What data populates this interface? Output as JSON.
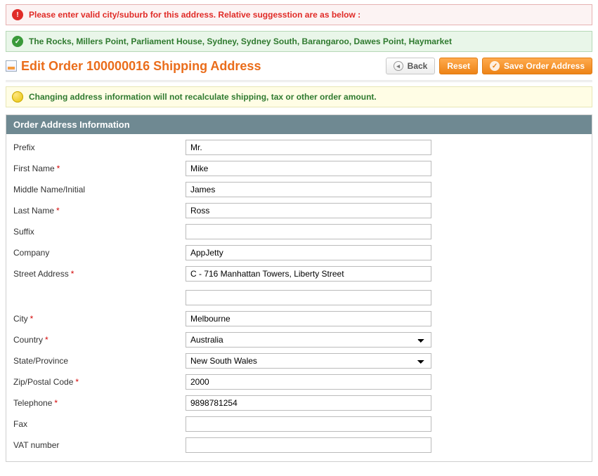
{
  "messages": {
    "error": "Please enter valid city/suburb for this address. Relative suggesstion are as below :",
    "success": "The Rocks, Millers Point, Parliament House, Sydney, Sydney South, Barangaroo, Dawes Point, Haymarket",
    "notice": "Changing address information will not recalculate shipping, tax or other order amount."
  },
  "header": {
    "title": "Edit Order 100000016 Shipping Address"
  },
  "buttons": {
    "back": "Back",
    "reset": "Reset",
    "save": "Save Order Address"
  },
  "panel": {
    "title": "Order Address Information"
  },
  "labels": {
    "prefix": "Prefix",
    "first_name": "First Name",
    "middle_name": "Middle Name/Initial",
    "last_name": "Last Name",
    "suffix": "Suffix",
    "company": "Company",
    "street": "Street Address",
    "city": "City",
    "country": "Country",
    "state": "State/Province",
    "zip": "Zip/Postal Code",
    "telephone": "Telephone",
    "fax": "Fax",
    "vat": "VAT number"
  },
  "required_marker": "*",
  "values": {
    "prefix": "Mr.",
    "first_name": "Mike",
    "middle_name": "James",
    "last_name": "Ross",
    "suffix": "",
    "company": "AppJetty",
    "street1": "C - 716 Manhattan Towers, Liberty Street",
    "street2": "",
    "city": "Melbourne",
    "country": "Australia",
    "state": "New South Wales",
    "zip": "2000",
    "telephone": "9898781254",
    "fax": "",
    "vat": ""
  }
}
